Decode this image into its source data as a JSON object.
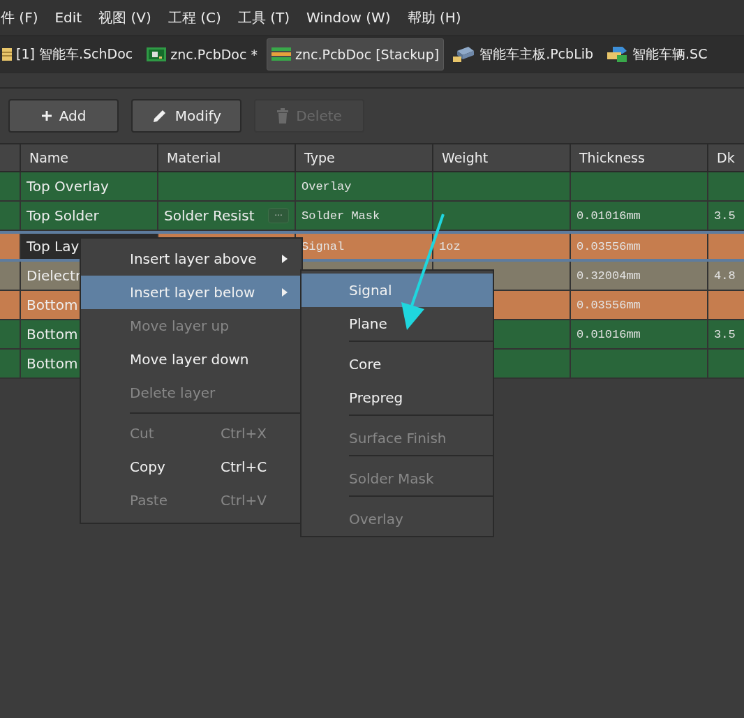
{
  "menu_bar": [
    {
      "label": "件 (F)"
    },
    {
      "label": "Edit"
    },
    {
      "label": "视图 (V)"
    },
    {
      "label": "工程 (C)"
    },
    {
      "label": "工具 (T)"
    },
    {
      "label": "Window (W)"
    },
    {
      "label": "帮助 (H)"
    }
  ],
  "document_tabs": [
    {
      "label": "[1] 智能车.SchDoc",
      "kind": "schematic",
      "selected": false
    },
    {
      "label": "znc.PcbDoc *",
      "kind": "pcb",
      "selected": false
    },
    {
      "label": "znc.PcbDoc [Stackup]",
      "kind": "stackup",
      "selected": true
    },
    {
      "label": "智能车主板.PcbLib",
      "kind": "library",
      "selected": false
    },
    {
      "label": "智能车辆.SC",
      "kind": "component",
      "selected": false
    }
  ],
  "toolbar": [
    {
      "label": "Add",
      "kind": "add",
      "disabled": false
    },
    {
      "label": "Modify",
      "kind": "modify",
      "disabled": false
    },
    {
      "label": "Delete",
      "kind": "delete",
      "disabled": true
    }
  ],
  "table": {
    "columns": [
      "Name",
      "Material",
      "Type",
      "Weight",
      "Thickness",
      "Dk"
    ],
    "rows": [
      {
        "color": "#29663a",
        "selected": false,
        "cells": [
          "Top Overlay",
          "",
          "Overlay",
          "",
          "",
          ""
        ]
      },
      {
        "color": "#29663a",
        "selected": false,
        "cells": [
          "Top Solder",
          "Solder Resist",
          "Solder Mask",
          "",
          "0.01016mm",
          "3.5"
        ],
        "material_button": "···"
      },
      {
        "color": "#c67d4e",
        "selected": true,
        "cells": [
          "Top Lay",
          "",
          "Signal",
          "1oz",
          "0.03556mm",
          ""
        ]
      },
      {
        "color": "#817b69",
        "selected": false,
        "cells": [
          "Dielectr",
          "",
          "",
          "",
          "0.32004mm",
          "4.8"
        ]
      },
      {
        "color": "#c67d4e",
        "selected": false,
        "cells": [
          "Bottom",
          "",
          "",
          "",
          "0.03556mm",
          ""
        ]
      },
      {
        "color": "#29663a",
        "selected": false,
        "cells": [
          "Bottom",
          "",
          "",
          "",
          "0.01016mm",
          "3.5"
        ]
      },
      {
        "color": "#29663a",
        "selected": false,
        "cells": [
          "Bottom",
          "",
          "",
          "",
          "",
          ""
        ]
      }
    ]
  },
  "context_menu": [
    {
      "kind": "item",
      "label": "Insert layer above",
      "disabled": false,
      "selected": false,
      "has_submenu": true
    },
    {
      "kind": "item",
      "label": "Insert layer below",
      "disabled": false,
      "selected": true,
      "has_submenu": true
    },
    {
      "kind": "item",
      "label": "Move layer up",
      "disabled": true,
      "selected": false,
      "has_submenu": false
    },
    {
      "kind": "item",
      "label": "Move layer down",
      "disabled": false,
      "selected": false,
      "has_submenu": false
    },
    {
      "kind": "item",
      "label": "Delete layer",
      "disabled": true,
      "selected": false,
      "has_submenu": false
    },
    {
      "kind": "separator"
    },
    {
      "kind": "item",
      "label": "Cut",
      "shortcut": "Ctrl+X",
      "disabled": true,
      "selected": false,
      "has_submenu": false
    },
    {
      "kind": "item",
      "label": "Copy",
      "shortcut": "Ctrl+C",
      "disabled": false,
      "selected": false,
      "has_submenu": false
    },
    {
      "kind": "item",
      "label": "Paste",
      "shortcut": "Ctrl+V",
      "disabled": true,
      "selected": false,
      "has_submenu": false
    }
  ],
  "submenu": [
    {
      "kind": "item",
      "label": "Signal",
      "disabled": false,
      "selected": true
    },
    {
      "kind": "item",
      "label": "Plane",
      "disabled": false,
      "selected": false
    },
    {
      "kind": "separator"
    },
    {
      "kind": "item",
      "label": "Core",
      "disabled": false,
      "selected": false
    },
    {
      "kind": "item",
      "label": "Prepreg",
      "disabled": false,
      "selected": false
    },
    {
      "kind": "separator"
    },
    {
      "kind": "item",
      "label": "Surface Finish",
      "disabled": true,
      "selected": false
    },
    {
      "kind": "separator"
    },
    {
      "kind": "item",
      "label": "Solder Mask",
      "disabled": true,
      "selected": false
    },
    {
      "kind": "separator"
    },
    {
      "kind": "item",
      "label": "Overlay",
      "disabled": true,
      "selected": false
    }
  ]
}
